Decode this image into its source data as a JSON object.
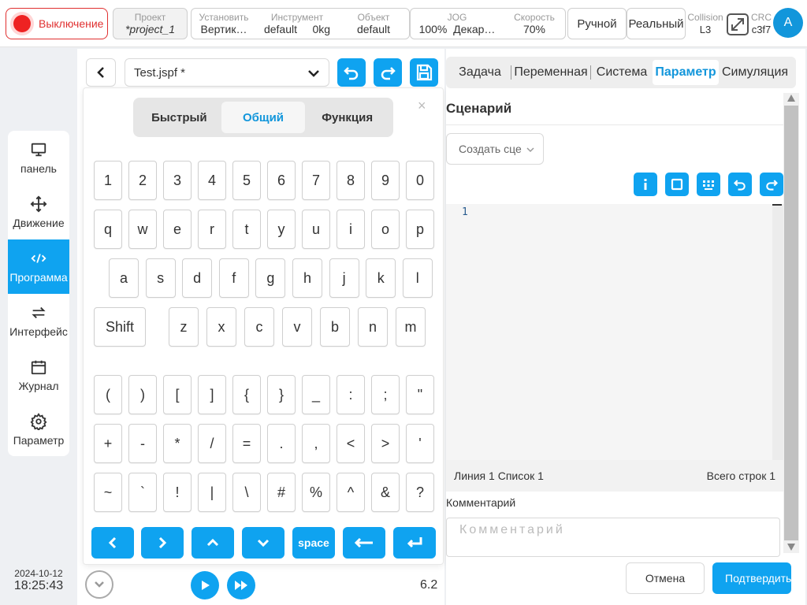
{
  "topbar": {
    "power_label": "Выключение",
    "project": {
      "label": "Проект",
      "value": "*project_1"
    },
    "install": {
      "label": "Установить",
      "value": "Вертик…"
    },
    "tool": {
      "label": "Инструмент",
      "value1": "default",
      "value2": "0kg"
    },
    "object": {
      "label": "Объект",
      "value": "default"
    },
    "jog": {
      "label": "JOG",
      "value1": "100%",
      "value2": "Декар…"
    },
    "speed": {
      "label": "Скорость",
      "value": "70%"
    },
    "manual_label": "Ручной",
    "real_label": "Реальный",
    "collision": {
      "label": "Collision",
      "value": "L3"
    },
    "crc": {
      "label": "CRC",
      "value": "c3f7"
    },
    "avatar_letter": "A"
  },
  "sidebar": {
    "items": [
      {
        "label": "панель",
        "icon": "monitor-icon"
      },
      {
        "label": "Движение",
        "icon": "move-icon"
      },
      {
        "label": "Программа",
        "icon": "code-icon"
      },
      {
        "label": "Интерфейс",
        "icon": "swap-icon"
      },
      {
        "label": "Журнал",
        "icon": "calendar-icon"
      },
      {
        "label": "Параметр",
        "icon": "gear-icon"
      }
    ],
    "active_index": 2
  },
  "datetime": {
    "date": "2024-10-12",
    "time": "18:25:43"
  },
  "file": {
    "name": "Test.jspf *"
  },
  "keyboard": {
    "tabs": [
      "Быстрый",
      "Общий",
      "Функция"
    ],
    "active_tab": 1,
    "close": "×",
    "rows": [
      [
        "1",
        "2",
        "3",
        "4",
        "5",
        "6",
        "7",
        "8",
        "9",
        "0"
      ],
      [
        "q",
        "w",
        "e",
        "r",
        "t",
        "y",
        "u",
        "i",
        "o",
        "p"
      ],
      [
        "a",
        "s",
        "d",
        "f",
        "g",
        "h",
        "j",
        "k",
        "l"
      ],
      [
        "z",
        "x",
        "c",
        "v",
        "b",
        "n",
        "m"
      ],
      [
        "(",
        ")",
        "[",
        "]",
        "{",
        "}",
        "_",
        ":",
        ";",
        "\""
      ],
      [
        "+",
        "-",
        "*",
        "/",
        "=",
        ".",
        ",",
        "<",
        ">",
        "'"
      ],
      [
        "~",
        "`",
        "!",
        "|",
        "\\",
        "#",
        "%",
        "^",
        "&",
        "?"
      ]
    ],
    "shift_label": "Shift",
    "space_label": "space"
  },
  "version": "6.2",
  "right": {
    "tabs": [
      "Задача",
      "Переменная",
      "Система",
      "Параметр",
      "Симуляция"
    ],
    "active_tab": 3,
    "scenario_title": "Сценарий",
    "create_placeholder": "Создать сце",
    "editor_line": "1",
    "status_left": "Линия 1 Список 1",
    "status_right": "Всего строк 1",
    "comment_label": "Комментарий",
    "comment_placeholder": "Комментарий",
    "cancel_label": "Отмена",
    "confirm_label": "Подтвердить"
  },
  "colors": {
    "accent": "#0fa3f0",
    "danger": "#e03030"
  }
}
